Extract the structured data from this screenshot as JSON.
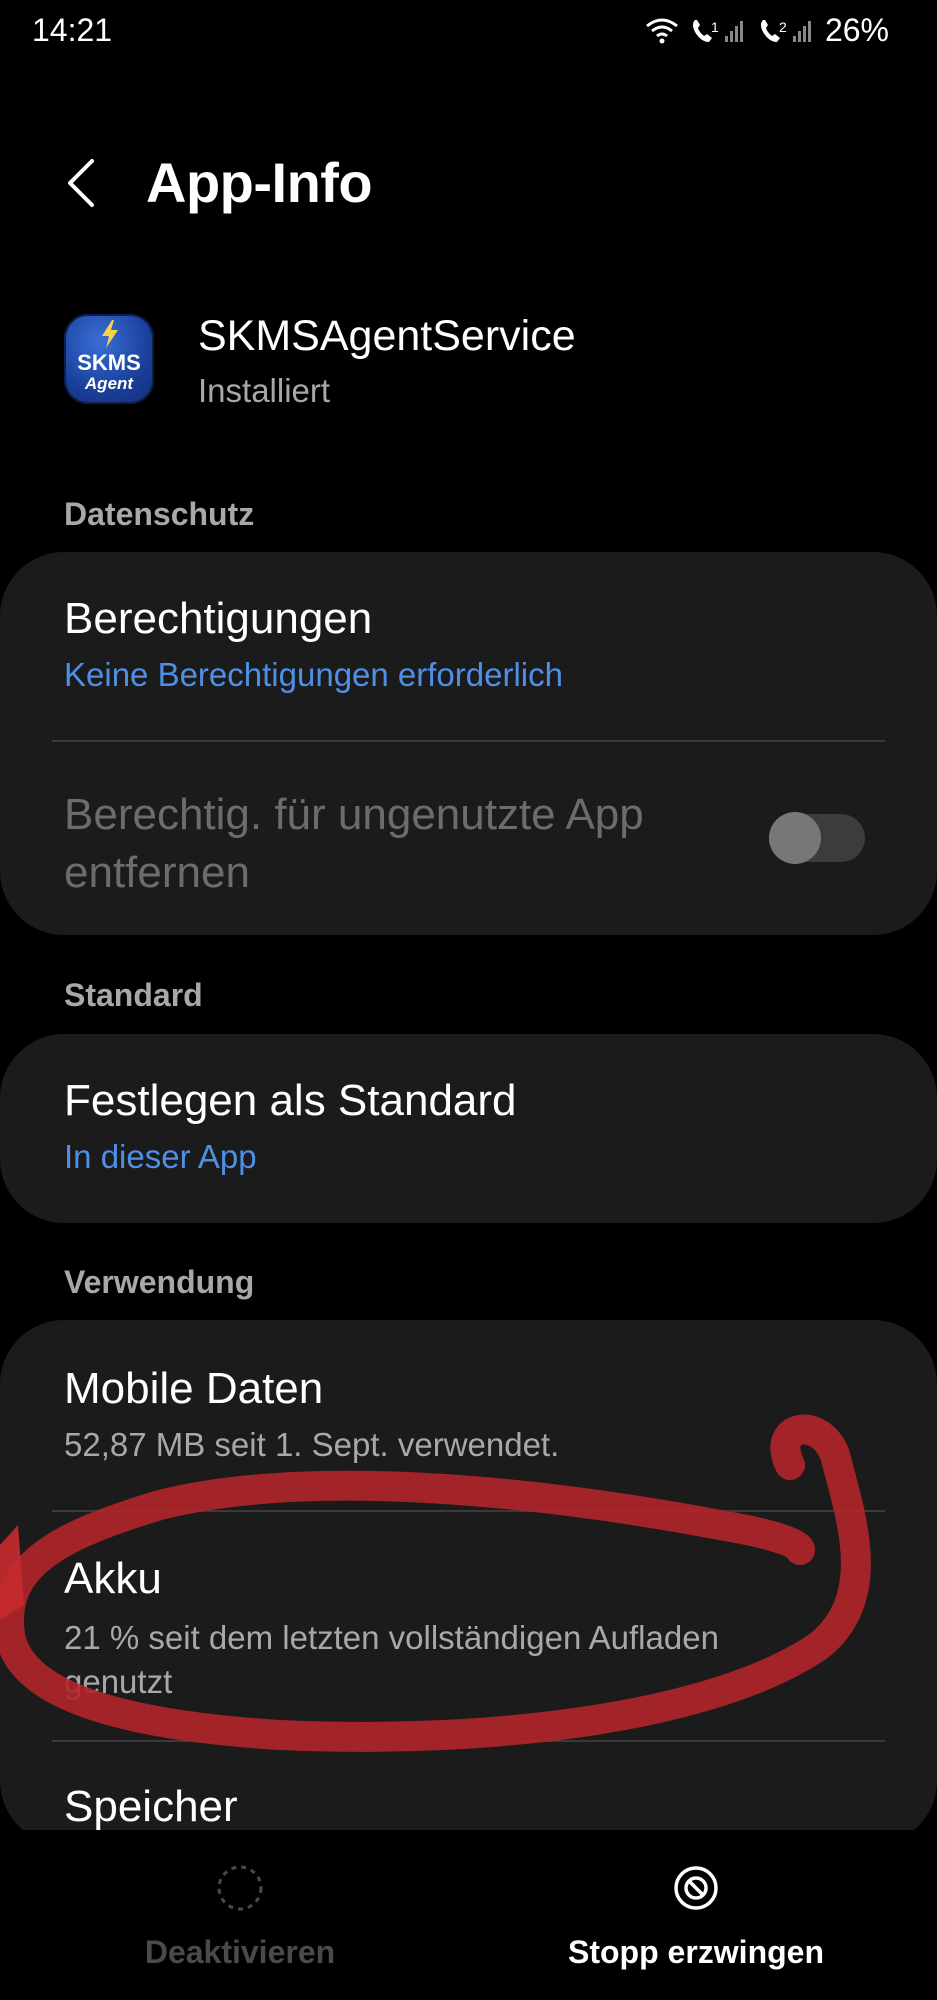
{
  "status_bar": {
    "time": "14:21",
    "battery": "26%",
    "sim1": "1",
    "sim2": "2"
  },
  "header": {
    "title": "App-Info"
  },
  "app": {
    "name": "SKMSAgentService",
    "status": "Installiert",
    "icon_line1": "SKMS",
    "icon_line2": "Agent"
  },
  "sections": {
    "privacy": {
      "label": "Datenschutz",
      "permissions_title": "Berechtigungen",
      "permissions_sub": "Keine Berechtigungen erforderlich",
      "remove_title_line1": "Berechtig. für ungenutzte App",
      "remove_title_line2": "entfernen",
      "remove_toggle_on": false
    },
    "default": {
      "label": "Standard",
      "title": "Festlegen als Standard",
      "sub": "In dieser App"
    },
    "usage": {
      "label": "Verwendung",
      "mobile_title": "Mobile Daten",
      "mobile_sub": "52,87 MB seit 1. Sept. verwendet.",
      "battery_title": "Akku",
      "battery_sub_line1": "21 % seit dem letzten vollständigen Aufladen",
      "battery_sub_line2": "genutzt",
      "storage_title": "Speicher"
    }
  },
  "bottom_bar": {
    "disable_label": "Deaktivieren",
    "force_stop_label": "Stopp erzwingen"
  },
  "colors": {
    "background": "#000000",
    "card": "#1b1b1b",
    "accent_blue": "#4f8fe6",
    "annotation_red": "#b3262a"
  }
}
